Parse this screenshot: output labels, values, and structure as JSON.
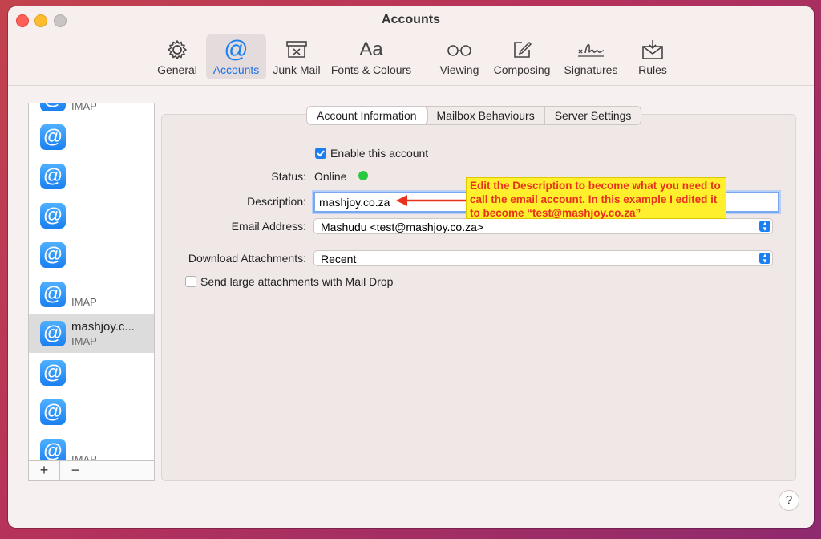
{
  "window": {
    "title": "Accounts"
  },
  "toolbar": {
    "items": [
      {
        "label": "General",
        "icon": "gear-icon"
      },
      {
        "label": "Accounts",
        "icon": "at-icon"
      },
      {
        "label": "Junk Mail",
        "icon": "junk-tray-icon"
      },
      {
        "label": "Fonts & Colours",
        "icon": "font-aa-icon"
      },
      {
        "label": "Viewing",
        "icon": "glasses-icon"
      },
      {
        "label": "Composing",
        "icon": "compose-icon"
      },
      {
        "label": "Signatures",
        "icon": "signature-icon"
      },
      {
        "label": "Rules",
        "icon": "rules-envelope-icon"
      }
    ],
    "active": "Accounts",
    "at_glyph": "@",
    "aa_glyph": "Aa"
  },
  "sidebar": {
    "accounts": [
      {
        "name": "",
        "type": "IMAP"
      },
      {
        "name": "",
        "type": ""
      },
      {
        "name": "",
        "type": ""
      },
      {
        "name": "",
        "type": ""
      },
      {
        "name": "",
        "type": ""
      },
      {
        "name": "",
        "type": "IMAP"
      },
      {
        "name": "mashjoy.c...",
        "type": "IMAP",
        "selected": true
      },
      {
        "name": "",
        "type": ""
      },
      {
        "name": "",
        "type": ""
      },
      {
        "name": "",
        "type": "IMAP"
      }
    ],
    "icon_glyph": "@",
    "add_label": "+",
    "remove_label": "−"
  },
  "tabs": [
    {
      "label": "Account Information",
      "active": true
    },
    {
      "label": "Mailbox Behaviours"
    },
    {
      "label": "Server Settings"
    }
  ],
  "form": {
    "enable_label": "Enable this account",
    "enable_checked": true,
    "status_label": "Status:",
    "status_value": "Online",
    "status_color": "#2ac840",
    "description_label": "Description:",
    "description_value": "mashjoy.co.za",
    "email_label": "Email Address:",
    "email_value": "Mashudu <test@mashjoy.co.za>",
    "download_label": "Download Attachments:",
    "download_value": "Recent",
    "maildrop_label": "Send large attachments with Mail Drop",
    "maildrop_checked": false
  },
  "annotation": {
    "text": "Edit the Description to become what you need to call the email account. In this example I edited it to become “test@mashjoy.co.za”",
    "arrow_color": "#e8321c",
    "background": "#ffef2d"
  },
  "help_label": "?",
  "colors": {
    "accent": "#1a7ff0"
  }
}
